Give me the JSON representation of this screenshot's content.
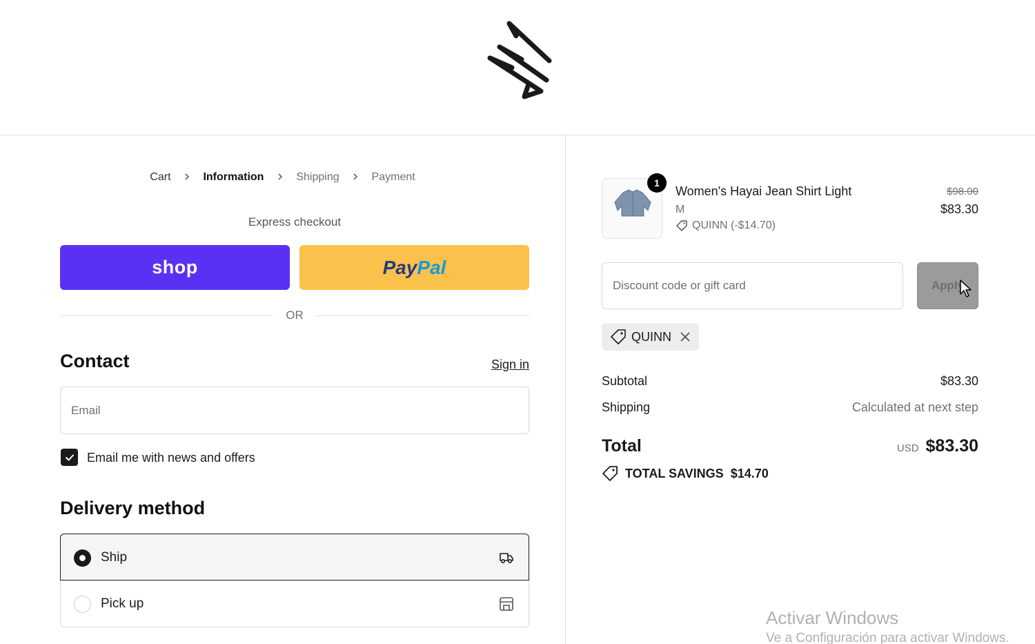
{
  "header": {
    "logo": "squiggle-logo"
  },
  "breadcrumb": {
    "items": [
      "Cart",
      "Information",
      "Shipping",
      "Payment"
    ]
  },
  "express": {
    "title": "Express checkout",
    "shop_label": "shop",
    "paypal_label_1": "Pay",
    "paypal_label_2": "Pal",
    "shop_color": "#5a31f4",
    "paypal_color": "#fcc14b"
  },
  "or_text": "OR",
  "contact": {
    "title": "Contact",
    "sign_in": "Sign in",
    "email_placeholder": "Email",
    "newsletter_label": "Email me with news and offers",
    "newsletter_checked": true
  },
  "delivery": {
    "title": "Delivery method",
    "options": [
      {
        "label": "Ship",
        "selected": true,
        "icon": "truck-icon"
      },
      {
        "label": "Pick up",
        "selected": false,
        "icon": "store-icon"
      }
    ]
  },
  "order": {
    "quantity": "1",
    "item_name": "Women's Hayai Jean Shirt Light",
    "variant": "M",
    "discount_line": "QUINN (-$14.70)",
    "price_original": "$98.00",
    "price_final": "$83.30"
  },
  "discount": {
    "placeholder": "Discount code or gift card",
    "apply_label": "Apply",
    "applied_code": "QUINN"
  },
  "summary": {
    "subtotal_label": "Subtotal",
    "subtotal_value": "$83.30",
    "shipping_label": "Shipping",
    "shipping_value": "Calculated at next step",
    "total_label": "Total",
    "currency": "USD",
    "total_value": "$83.30",
    "savings_label": "TOTAL SAVINGS",
    "savings_value": "$14.70"
  },
  "watermark": {
    "line1": "Activar Windows",
    "line2": "Ve a Configuración para activar Windows."
  }
}
